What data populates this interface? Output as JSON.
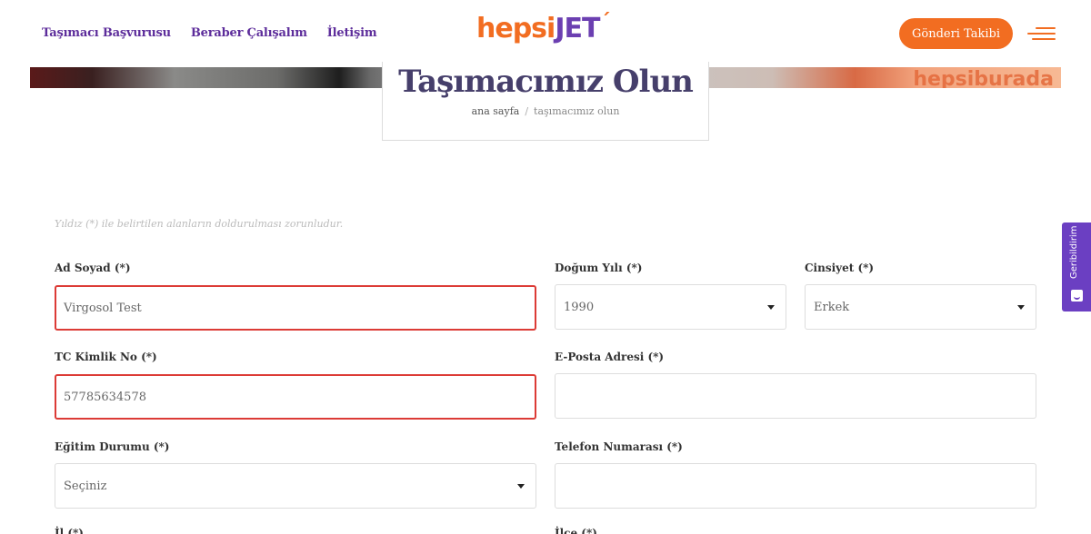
{
  "header": {
    "nav": [
      "Taşımacı Başvurusu",
      "Beraber Çalışalım",
      "İletişim"
    ],
    "logo_part1": "hepsi",
    "logo_part2": "JET",
    "logo_tick": "´",
    "track_button": "Gönderi Takibi",
    "menu_icon": "hamburger-menu-icon",
    "brand_color": "#f26d21",
    "accent_color": "#5d2d9b"
  },
  "banner": {
    "brand_text": "hepsiburada"
  },
  "page": {
    "title": "Taşımacımız Olun",
    "breadcrumb": {
      "home": "ana sayfa",
      "separator": "/",
      "current": "taşımacımız olun"
    }
  },
  "form": {
    "note": "Yıldız (*) ile belirtilen alanların doldurulması zorunludur.",
    "name": {
      "label": "Ad Soyad (*)",
      "value": "Virgosol Test"
    },
    "birth_year": {
      "label": "Doğum Yılı (*)",
      "value": "1990"
    },
    "gender": {
      "label": "Cinsiyet (*)",
      "value": "Erkek"
    },
    "tc": {
      "label": "TC Kimlik No (*)",
      "value": "57785634578"
    },
    "email": {
      "label": "E-Posta Adresi (*)",
      "value": ""
    },
    "education": {
      "label": "Eğitim Durumu (*)",
      "value": "Seçiniz"
    },
    "phone": {
      "label": "Telefon Numarası (*)",
      "value": ""
    },
    "city": {
      "label": "İl (*)"
    },
    "district": {
      "label": "İlçe (*)"
    }
  },
  "feedback": {
    "label": "Geribildirim",
    "icon": "smiley-icon"
  }
}
